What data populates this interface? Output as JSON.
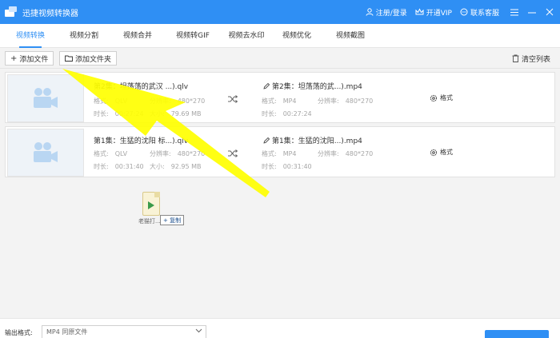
{
  "app": {
    "title": "迅捷视频转换器"
  },
  "titlebar": {
    "login": "注册/登录",
    "vip": "开通VIP",
    "support": "联系客服"
  },
  "tabs": [
    {
      "label": "视频转换",
      "active": true
    },
    {
      "label": "视频分割",
      "active": false
    },
    {
      "label": "视频合并",
      "active": false
    },
    {
      "label": "视频转GIF",
      "active": false
    },
    {
      "label": "视频去水印",
      "active": false
    },
    {
      "label": "视频优化",
      "active": false
    },
    {
      "label": "视频截图",
      "active": false
    }
  ],
  "toolbar": {
    "add_file": "添加文件",
    "add_folder": "添加文件夹",
    "clear_list": "清空列表"
  },
  "files": [
    {
      "source_name": "第2集：坦荡荡的武汉 ...).qlv",
      "format_label": "格式:",
      "format_value": "QLV",
      "resolution_label": "分辨率:",
      "resolution_value": "480*270",
      "duration_label": "时长:",
      "duration_value": "00:27:24",
      "size_label": "大小:",
      "size_value": "79.69 MB",
      "target_name": "第2集：坦荡荡的武...).mp4",
      "target_format_value": "MP4",
      "target_resolution_value": "480*270",
      "target_duration_value": "00:27:24",
      "settings_label": "格式"
    },
    {
      "source_name": "第1集：生猛的沈阳 标...).qlv",
      "format_label": "格式:",
      "format_value": "QLV",
      "resolution_label": "分辨率:",
      "resolution_value": "480*270",
      "duration_label": "时长:",
      "duration_value": "00:31:40",
      "size_label": "大小:",
      "size_value": "92.95 MB",
      "target_name": "第1集：生猛的沈阳...).mp4",
      "target_format_value": "MP4",
      "target_resolution_value": "480*270",
      "target_duration_value": "00:31:40",
      "settings_label": "格式"
    }
  ],
  "drag": {
    "file_label": "老猫打...",
    "copy_label": "+ 复制"
  },
  "footer": {
    "output_format_label": "输出格式:",
    "output_format_value": "MP4  同原文件"
  },
  "colors": {
    "brand": "#2f8ff4",
    "annotation_arrow": "#ffff00"
  }
}
